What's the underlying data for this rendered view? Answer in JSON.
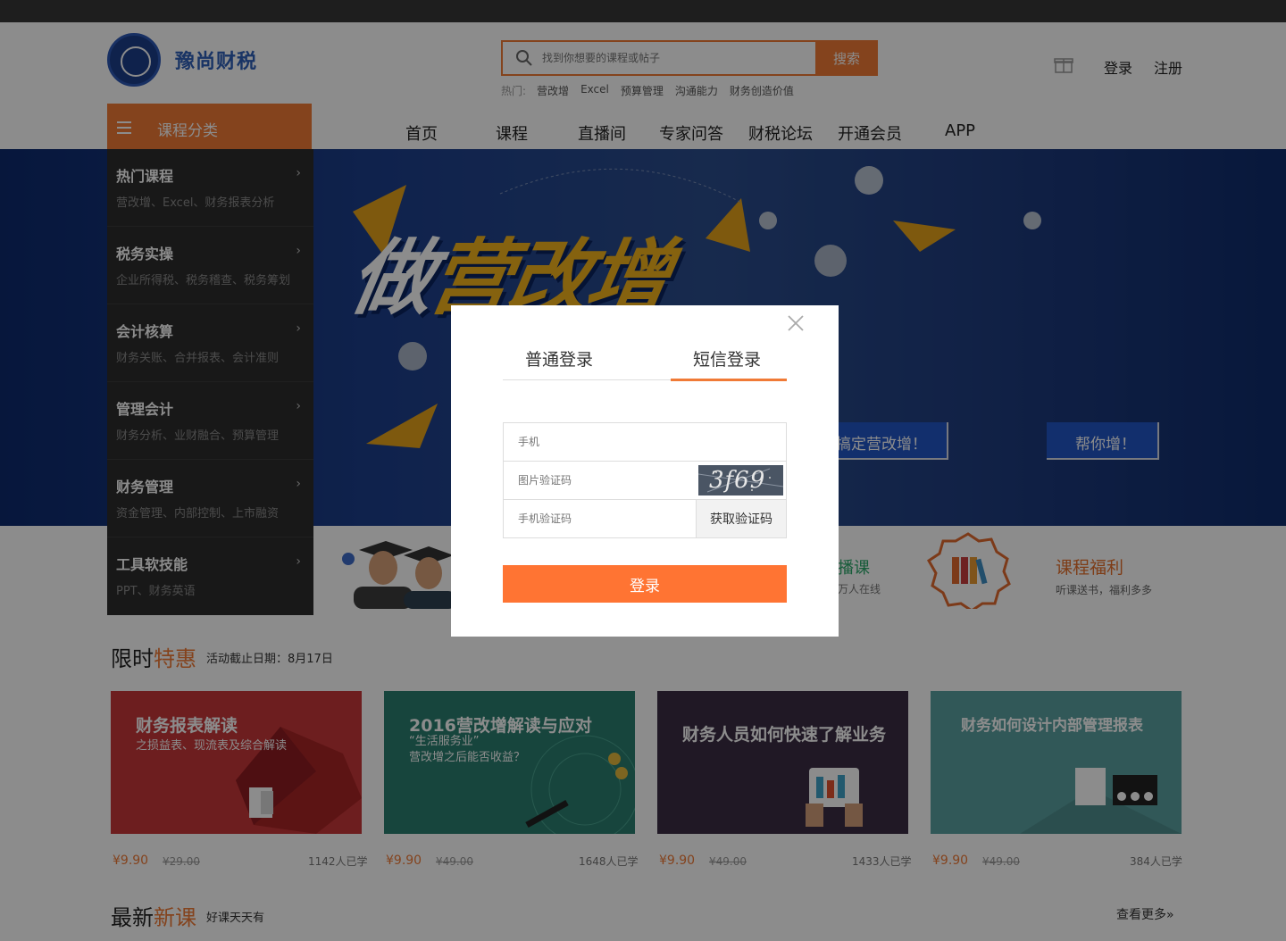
{
  "brand": {
    "name": "豫尚财税"
  },
  "search": {
    "placeholder": "找到你想要的课程或帖子",
    "button": "搜索"
  },
  "hot": {
    "label": "热门:",
    "items": [
      "营改增",
      "Excel",
      "预算管理",
      "沟通能力",
      "财务创造价值"
    ]
  },
  "account": {
    "login": "登录",
    "register": "注册"
  },
  "nav": {
    "category_label": "课程分类",
    "items": [
      "首页",
      "课程",
      "直播间",
      "专家问答",
      "财税论坛",
      "开通会员",
      "APP"
    ]
  },
  "hero": {
    "headline_first": "做",
    "headline_rest": "营改增",
    "badge1": "搞定营改增！",
    "badge2": "帮你增！"
  },
  "categories": [
    {
      "title": "热门课程",
      "sub": "营改增、Excel、财务报表分析"
    },
    {
      "title": "税务实操",
      "sub": "企业所得税、税务稽查、税务筹划"
    },
    {
      "title": "会计核算",
      "sub": "财务关账、合并报表、会计准则"
    },
    {
      "title": "管理会计",
      "sub": "财务分析、业财融合、预算管理"
    },
    {
      "title": "财务管理",
      "sub": "资金管理、内部控制、上市融资"
    },
    {
      "title": "工具软技能",
      "sub": "PPT、财务英语"
    }
  ],
  "features": {
    "live_title": "播课",
    "live_sub": "万人在线",
    "welfare_title": "课程福利",
    "welfare_sub": "听课送书，福利多多"
  },
  "sale": {
    "title_a": "限时",
    "title_b": "特惠",
    "deadline": "活动截止日期：8月17日"
  },
  "courses": [
    {
      "title": "财务报表解读",
      "subtitle": "之损益表、现流表及综合解读",
      "price": "¥9.90",
      "old": "¥29.00",
      "learned": "1142人已学",
      "color": "#c6383a"
    },
    {
      "title": "2016营改增解读与应对",
      "subtitle": "“生活服务业”\n营改增之后能否收益？",
      "price": "¥9.90",
      "old": "¥49.00",
      "learned": "1648人已学",
      "color": "#2a7e6f"
    },
    {
      "title": "财务人员如何快速了解业务",
      "subtitle": "",
      "price": "¥9.90",
      "old": "¥49.00",
      "learned": "1433人已学",
      "color": "#3b2d44"
    },
    {
      "title": "财务如何设计内部管理报表",
      "subtitle": "",
      "price": "¥9.90",
      "old": "¥49.00",
      "learned": "384人已学",
      "color": "#5aa0a0"
    }
  ],
  "newest": {
    "title_a": "最新",
    "title_b": "新课",
    "sub": "好课天天有",
    "more": "查看更多»"
  },
  "modal": {
    "tab_normal": "普通登录",
    "tab_sms": "短信登录",
    "phone_placeholder": "手机",
    "captcha_placeholder": "图片验证码",
    "captcha_text": "3f69",
    "sms_placeholder": "手机验证码",
    "sms_button": "获取验证码",
    "submit": "登录"
  },
  "colors": {
    "accent": "#f07a36",
    "nav_dark": "#2d2d2d",
    "brand_blue": "#2f5fb8"
  }
}
